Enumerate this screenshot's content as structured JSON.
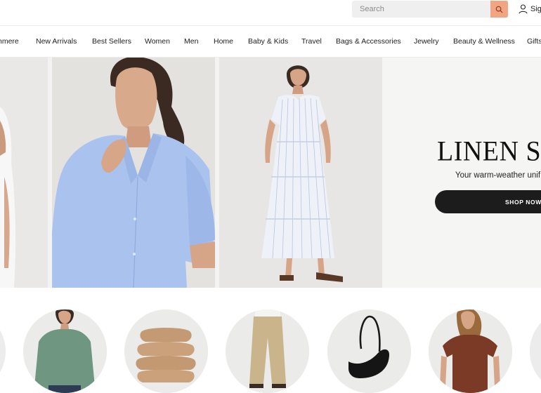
{
  "header": {
    "search": {
      "placeholder": "Search",
      "value": ""
    },
    "signin_label": "Sig"
  },
  "nav": {
    "items": [
      {
        "label": "hmere"
      },
      {
        "label": "New Arrivals"
      },
      {
        "label": "Best Sellers"
      },
      {
        "label": "Women"
      },
      {
        "label": "Men"
      },
      {
        "label": "Home"
      },
      {
        "label": "Baby & Kids"
      },
      {
        "label": "Travel"
      },
      {
        "label": "Bags & Accessories"
      },
      {
        "label": "Jewelry"
      },
      {
        "label": "Beauty & Wellness"
      },
      {
        "label": "Gifts"
      }
    ]
  },
  "hero": {
    "title": "LINEN SE",
    "subtitle": "Your warm-weather unif",
    "cta_label": "SHOP NOW"
  },
  "colors": {
    "accent": "#f2a582",
    "cta_bg": "#1c1c1c"
  }
}
